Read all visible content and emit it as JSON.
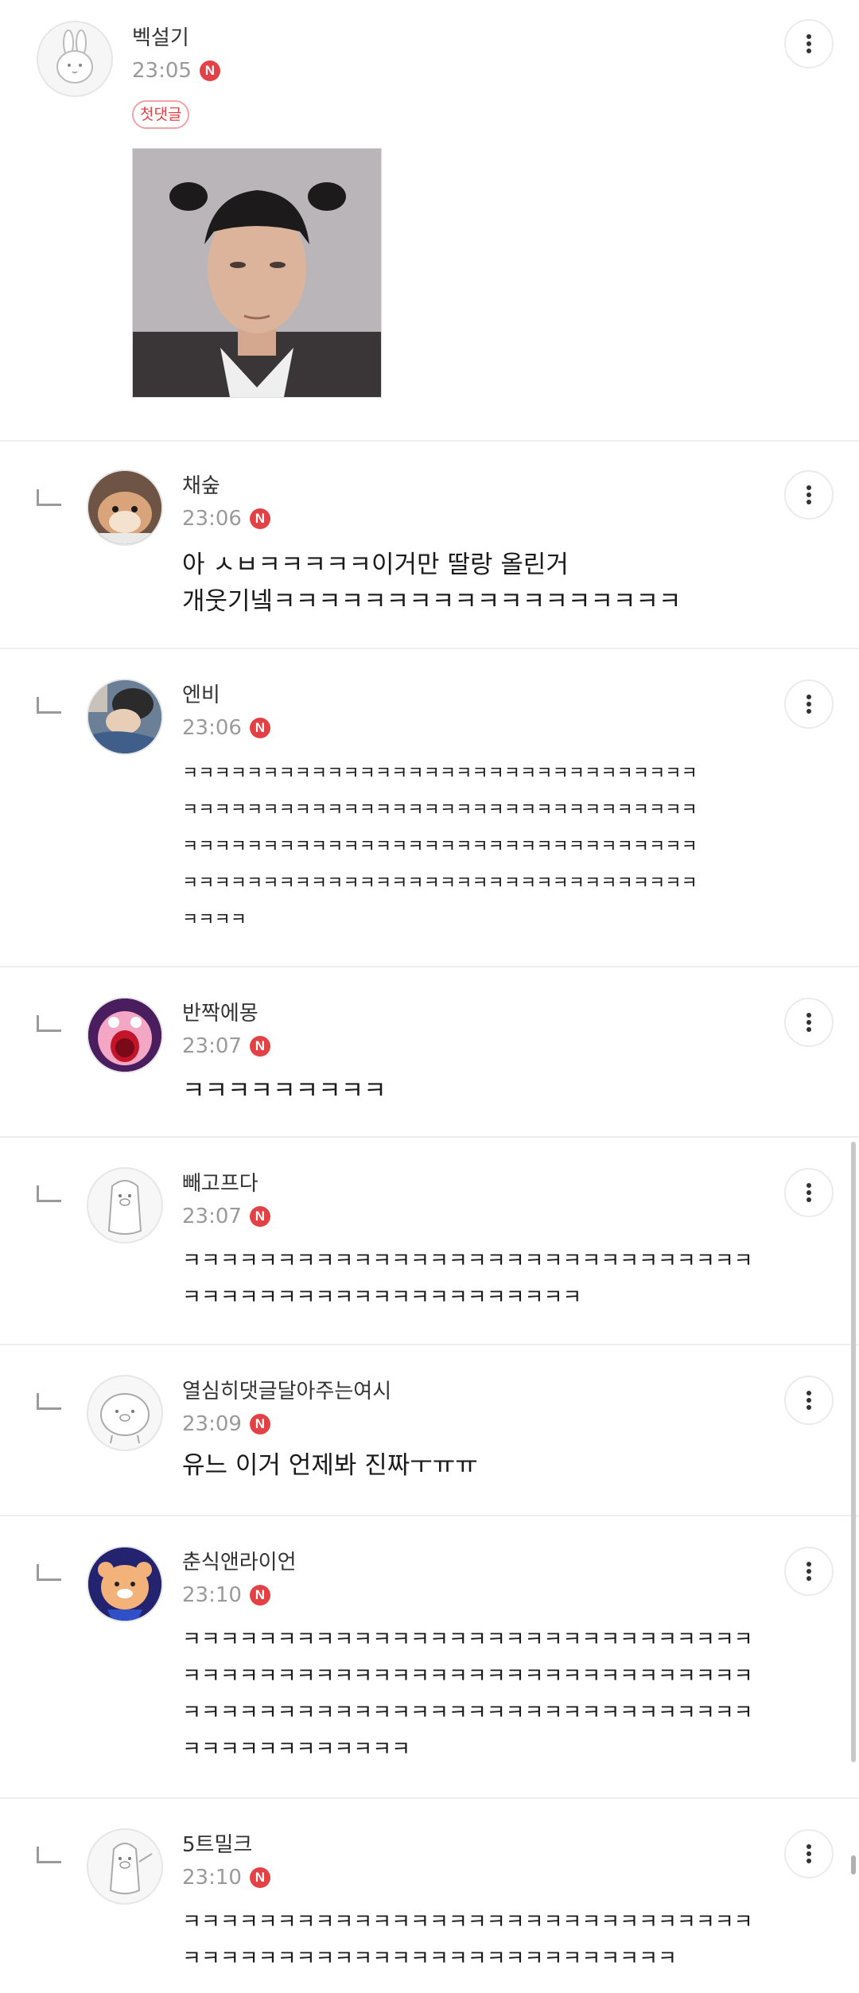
{
  "comments": [
    {
      "author": "벡설기",
      "time": "23:05",
      "badge": "N",
      "first_comment_tag": "첫댓글",
      "avatar_icon": "bunny-avatar-icon",
      "has_photo": true
    },
    {
      "author": "채숲",
      "time": "23:06",
      "badge": "N",
      "text_lines": [
        "아 ㅅㅂㅋㅋㅋㅋㅋ이거만 딸랑 올린거",
        "개웃기넼ㅋㅋㅋㅋㅋㅋㅋㅋㅋㅋㅋㅋㅋㅋㅋㅋㅋㅋ"
      ],
      "avatar_icon": "hamster-avatar-icon"
    },
    {
      "author": "엔비",
      "time": "23:06",
      "badge": "N",
      "text_lines": [
        "ㅋㅋㅋㅋㅋㅋㅋㅋㅋㅋㅋㅋㅋㅋㅋㅋㅋㅋㅋㅋㅋㅋㅋㅋㅋㅋㅋㅋㅋㅋㅋㅋ",
        "ㅋㅋㅋㅋㅋㅋㅋㅋㅋㅋㅋㅋㅋㅋㅋㅋㅋㅋㅋㅋㅋㅋㅋㅋㅋㅋㅋㅋㅋㅋㅋㅋ",
        "ㅋㅋㅋㅋㅋㅋㅋㅋㅋㅋㅋㅋㅋㅋㅋㅋㅋㅋㅋㅋㅋㅋㅋㅋㅋㅋㅋㅋㅋㅋㅋㅋ",
        "ㅋㅋㅋㅋㅋㅋㅋㅋㅋㅋㅋㅋㅋㅋㅋㅋㅋㅋㅋㅋㅋㅋㅋㅋㅋㅋㅋㅋㅋㅋㅋㅋ",
        "ㅋㅋㅋㅋ"
      ],
      "avatar_icon": "sleeping-person-avatar-icon"
    },
    {
      "author": "반짝에몽",
      "time": "23:07",
      "badge": "N",
      "text_lines": [
        "ㅋㅋㅋㅋㅋㅋㅋㅋㅋ"
      ],
      "avatar_icon": "crying-character-avatar-icon"
    },
    {
      "author": "빼고프다",
      "time": "23:07",
      "badge": "N",
      "text_lines": [
        "ㅋㅋㅋㅋㅋㅋㅋㅋㅋㅋㅋㅋㅋㅋㅋㅋㅋㅋㅋㅋㅋㅋㅋㅋㅋㅋㅋㅋㅋㅋ",
        "ㅋㅋㅋㅋㅋㅋㅋㅋㅋㅋㅋㅋㅋㅋㅋㅋㅋㅋㅋㅋㅋ"
      ],
      "avatar_icon": "pig-avatar-icon"
    },
    {
      "author": "열심히댓글달아주는여시",
      "time": "23:09",
      "badge": "N",
      "text_lines": [
        "유느 이거 언제봐 진짜ㅜㅠㅠ"
      ],
      "avatar_icon": "pig-face-avatar-icon"
    },
    {
      "author": "춘식앤라이언",
      "time": "23:10",
      "badge": "N",
      "text_lines": [
        "ㅋㅋㅋㅋㅋㅋㅋㅋㅋㅋㅋㅋㅋㅋㅋㅋㅋㅋㅋㅋㅋㅋㅋㅋㅋㅋㅋㅋㅋㅋ",
        "ㅋㅋㅋㅋㅋㅋㅋㅋㅋㅋㅋㅋㅋㅋㅋㅋㅋㅋㅋㅋㅋㅋㅋㅋㅋㅋㅋㅋㅋㅋ",
        "ㅋㅋㅋㅋㅋㅋㅋㅋㅋㅋㅋㅋㅋㅋㅋㅋㅋㅋㅋㅋㅋㅋㅋㅋㅋㅋㅋㅋㅋㅋ",
        "ㅋㅋㅋㅋㅋㅋㅋㅋㅋㅋㅋㅋ"
      ],
      "avatar_icon": "bear-character-avatar-icon"
    },
    {
      "author": "5트밀크",
      "time": "23:10",
      "badge": "N",
      "text_lines": [
        "ㅋㅋㅋㅋㅋㅋㅋㅋㅋㅋㅋㅋㅋㅋㅋㅋㅋㅋㅋㅋㅋㅋㅋㅋㅋㅋㅋㅋㅋㅋ",
        "ㅋㅋㅋㅋㅋㅋㅋㅋㅋㅋㅋㅋㅋㅋㅋㅋㅋㅋㅋㅋㅋㅋㅋㅋㅋㅋ"
      ],
      "avatar_icon": "pig-waving-avatar-icon"
    }
  ],
  "more_icon": "more-vertical-icon",
  "reply_icon": "reply-arrow-icon"
}
